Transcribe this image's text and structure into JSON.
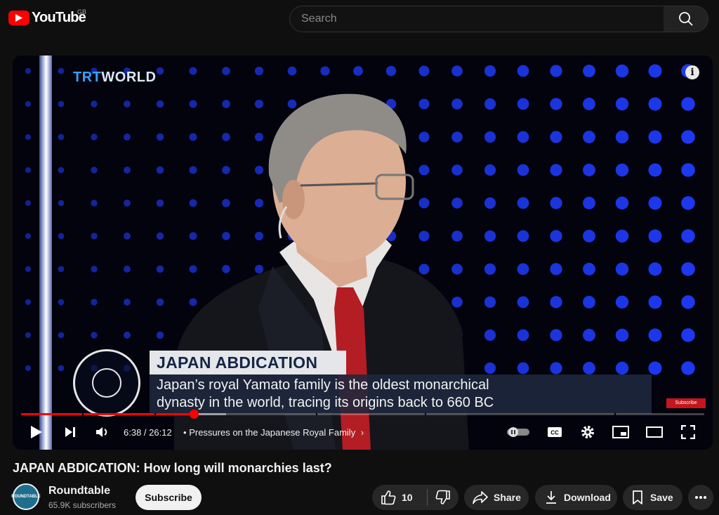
{
  "header": {
    "logo_text": "YouTube",
    "country_code": "GB",
    "search_placeholder": "Search"
  },
  "video": {
    "channel_overlay": {
      "part1": "TRT",
      "part2": "WORLD"
    },
    "lower_third": {
      "title": "JAPAN ABDICATION",
      "line1": "Japan’s royal Yamato family is the oldest monarchical",
      "line2": "dynasty in the world, tracing its origins back to 660 BC"
    },
    "subscribe_badge": "Subscribe",
    "player": {
      "current_time": "6:38",
      "duration": "26:12",
      "time_display": "6:38 / 26:12",
      "chapter_prefix": "•",
      "chapter": "Pressures on the Japanese Royal Family",
      "progress_fraction": 0.253,
      "buffered_fraction": 0.3
    }
  },
  "meta": {
    "title": "JAPAN ABDICATION: How long will monarchies last?",
    "channel_name": "Roundtable",
    "avatar_text": "ROUNDTABLE",
    "subscribers": "65.9K subscribers",
    "subscribe_label": "Subscribe",
    "like_count": "10",
    "share_label": "Share",
    "download_label": "Download",
    "save_label": "Save"
  },
  "colors": {
    "accent": "#ff0000",
    "background": "#0f0f0f",
    "pill": "#272727"
  }
}
